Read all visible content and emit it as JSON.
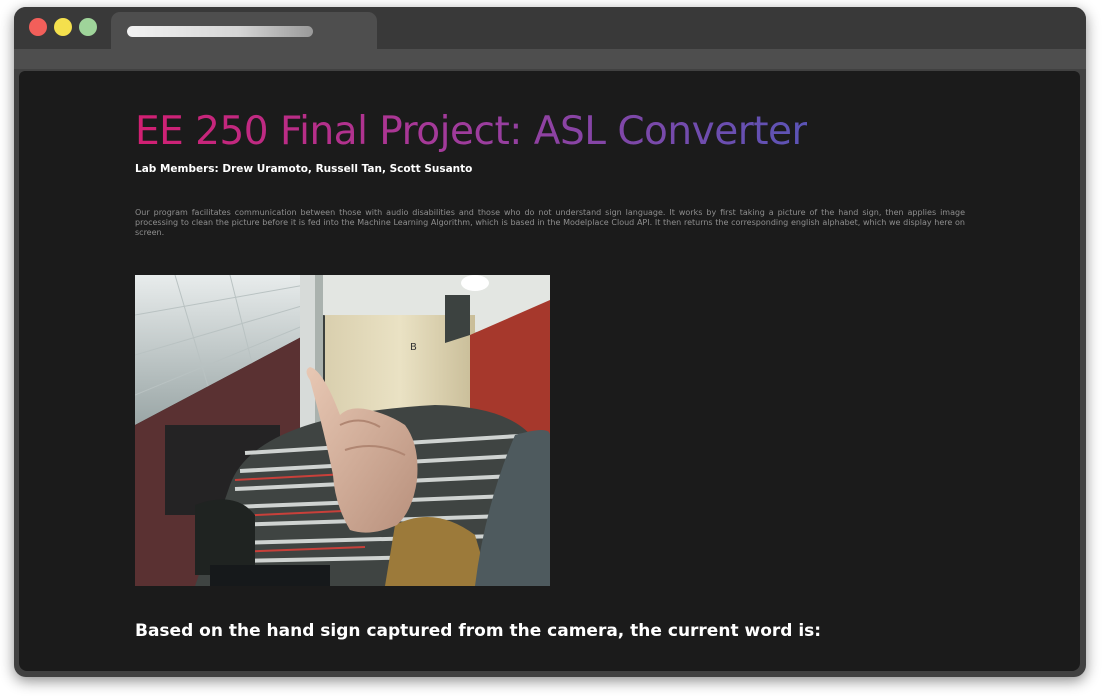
{
  "browser": {
    "controls": [
      "close",
      "minimize",
      "maximize"
    ],
    "tab_title": ""
  },
  "page": {
    "title": "EE 250 Final Project: ASL Converter",
    "lab_members": "Lab Members: Drew Uramoto, Russell Tan, Scott Susanto",
    "description": "Our program facilitates communication between those with audio disabilities and those who do not understand sign language. It works by first taking a picture of the hand sign, then applies image processing to clean the picture before it is fed into the Machine Learning Algorithm, which is based in the Modelplace Cloud API. It then returns the corresponding english alphabet, which we display here on screen.",
    "camera_image": "hand-sign-camera-capture",
    "result_text": "Based on the hand sign captured from the camera, the current word is:",
    "current_word": ""
  },
  "colors": {
    "title_gradient_start": "#d21f72",
    "title_gradient_end": "#5b54b6",
    "page_background": "#1b1b1b",
    "window_chrome": "#414141"
  }
}
